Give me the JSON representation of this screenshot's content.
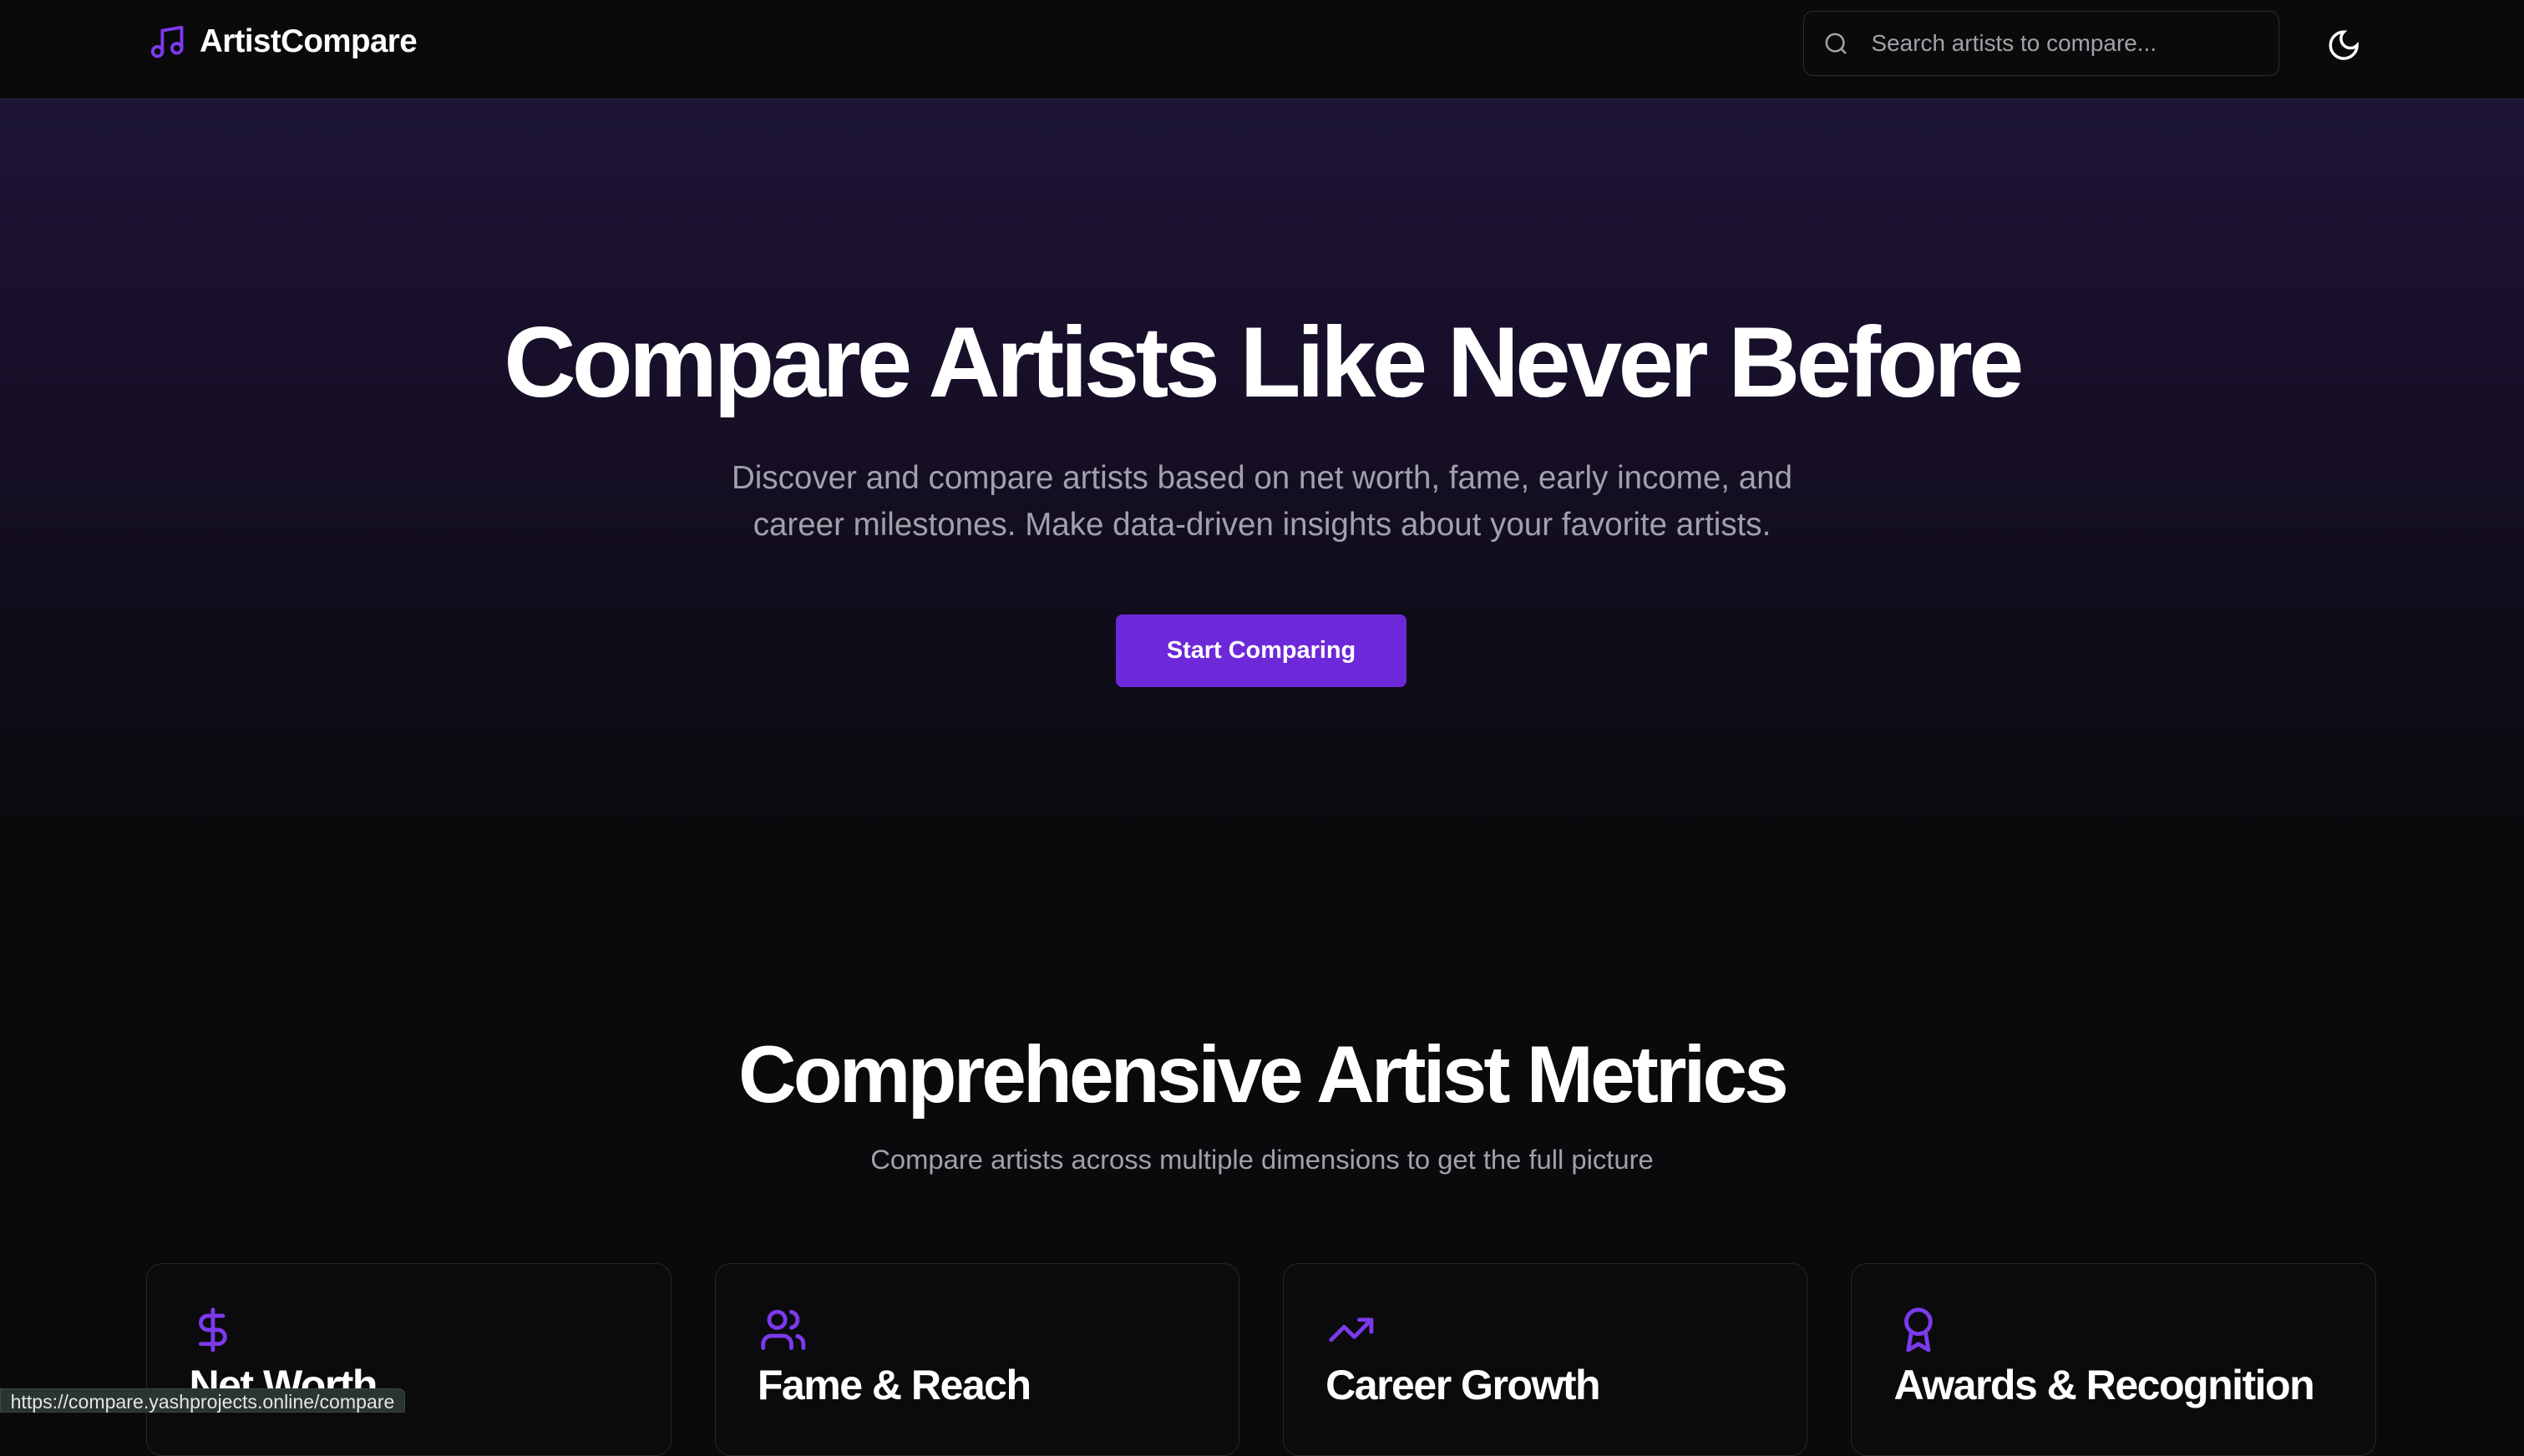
{
  "nav": {
    "brand": "ArtistCompare",
    "search_placeholder": "Search artists to compare..."
  },
  "hero": {
    "title": "Compare Artists Like Never Before",
    "subtitle_line1": "Discover and compare artists based on net worth, fame, early income, and",
    "subtitle_line2": "career milestones. Make data-driven insights about your favorite artists.",
    "cta": "Start Comparing"
  },
  "metrics": {
    "title": "Comprehensive Artist Metrics",
    "subtitle": "Compare artists across multiple dimensions to get the full picture",
    "cards": [
      {
        "title": "Net Worth",
        "icon": "dollar-icon"
      },
      {
        "title": "Fame & Reach",
        "icon": "users-icon"
      },
      {
        "title": "Career Growth",
        "icon": "trending-up-icon"
      },
      {
        "title": "Awards & Recognition",
        "icon": "award-icon"
      }
    ]
  },
  "status_url": "https://compare.yashprojects.online/compare",
  "colors": {
    "accent": "#6d28d9",
    "icon": "#7c3aed"
  }
}
